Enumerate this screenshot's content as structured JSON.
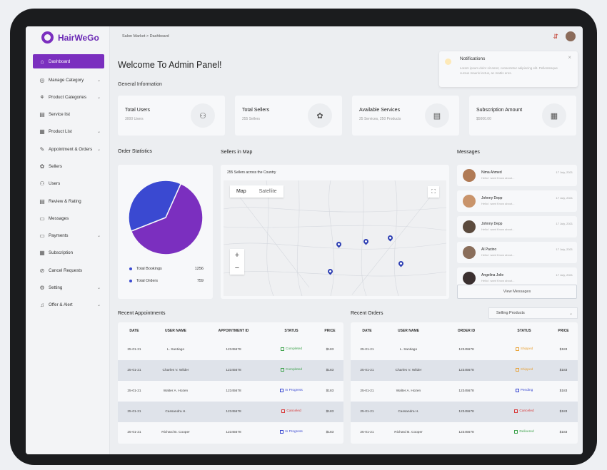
{
  "app": {
    "brand": "HairWeGo",
    "breadcrumb": "Salon Market  >  Dashboard"
  },
  "sidebar": {
    "items": [
      {
        "label": "Dashboard",
        "icon": "home-icon",
        "glyph": "⌂",
        "chev": false,
        "active": true
      },
      {
        "label": "Manage Category",
        "icon": "category-icon",
        "glyph": "◎",
        "chev": true
      },
      {
        "label": "Product Categories",
        "icon": "product-category-icon",
        "glyph": "⚘",
        "chev": true
      },
      {
        "label": "Service list",
        "icon": "document-icon",
        "glyph": "▤",
        "chev": false
      },
      {
        "label": "Product List",
        "icon": "grid-icon",
        "glyph": "▦",
        "chev": true
      },
      {
        "label": "Appointment & Orders",
        "icon": "edit-icon",
        "glyph": "✎",
        "chev": true
      },
      {
        "label": "Sellers",
        "icon": "seller-icon",
        "glyph": "✿",
        "chev": false
      },
      {
        "label": "Users",
        "icon": "users-icon",
        "glyph": "⚇",
        "chev": false
      },
      {
        "label": "Review & Rating",
        "icon": "review-icon",
        "glyph": "▤",
        "chev": false
      },
      {
        "label": "Messages",
        "icon": "message-icon",
        "glyph": "▭",
        "chev": false
      },
      {
        "label": "Payments",
        "icon": "payment-icon",
        "glyph": "▭",
        "chev": true
      },
      {
        "label": "Subscription",
        "icon": "subscription-icon",
        "glyph": "▦",
        "chev": false
      },
      {
        "label": "Cancel Requests",
        "icon": "cancel-icon",
        "glyph": "⊘",
        "chev": false
      },
      {
        "label": "Setting",
        "icon": "gear-icon",
        "glyph": "⚙",
        "chev": true
      },
      {
        "label": "Offer & Alert",
        "icon": "bell-icon",
        "glyph": "♫",
        "chev": true
      }
    ]
  },
  "main": {
    "welcome": "Welcome To Admin Panel!",
    "general": "General Information"
  },
  "notification": {
    "title": "Notifications",
    "text": "Lorem ipsum dolor sit amet, consectetur adipiscing elit. Pellentesque cursus mauris lectus, ac mattis eros."
  },
  "stats": [
    {
      "label": "Total Users",
      "sub": "3000 Users",
      "icon": "users-icon",
      "glyph": "⚇"
    },
    {
      "label": "Total Sellers",
      "sub": "255 Sellers",
      "icon": "seller-icon",
      "glyph": "✿"
    },
    {
      "label": "Available Services",
      "sub": "25 Services, 250 Products",
      "icon": "document-icon",
      "glyph": "▤"
    },
    {
      "label": "Subscription Amount",
      "sub": "$5000.00",
      "icon": "receipt-icon",
      "glyph": "▦"
    }
  ],
  "sections": {
    "order_stats": "Order Statistics",
    "sellers_map": "Sellers in Map",
    "messages": "Messages",
    "recent_appts": "Recent Appointments",
    "recent_orders": "Recent Orders"
  },
  "chart_data": {
    "type": "pie",
    "slices": [
      {
        "name": "Total Bookings",
        "value": 1256,
        "color": "#7b2fbf"
      },
      {
        "name": "Total Orders",
        "value": 759,
        "color": "#3a49d1"
      }
    ],
    "legend": [
      {
        "label": "Total Bookings",
        "value": "1256"
      },
      {
        "label": "Total Orders",
        "value": "759"
      }
    ]
  },
  "map": {
    "caption": "255 Sellers across the Country",
    "tab_map": "Map",
    "tab_satellite": "Satellite",
    "zoom_in": "+",
    "zoom_out": "−"
  },
  "messages": [
    {
      "name": "Nima Ahmed",
      "text": "Hello I want Know about...",
      "date": "17 July, 2021",
      "color": "#b07a55"
    },
    {
      "name": "Johnny Depp",
      "text": "Hello I want Know about...",
      "date": "17 July, 2021",
      "color": "#c9946b"
    },
    {
      "name": "Johnny Depp",
      "text": "Hello I want Know about...",
      "date": "17 July, 2021",
      "color": "#5b4a3d"
    },
    {
      "name": "Al Pacino",
      "text": "Hello I want Know about...",
      "date": "17 July, 2021",
      "color": "#8a6e5b"
    },
    {
      "name": "Angelina Jolie",
      "text": "Hello I want Know about...",
      "date": "17 July, 2021",
      "color": "#3b3030"
    }
  ],
  "view_messages": "View Messages",
  "orders_filter": "Selling Products",
  "appointments": {
    "headers": [
      "DATE",
      "USER NAME",
      "APPOINTMENT ID",
      "STATUS",
      "PRICE"
    ],
    "rows": [
      {
        "date": "25-01-21",
        "user": "L. Santiago",
        "id": "12345678",
        "status": "Completed",
        "price": "$183",
        "color": "#3fa34d"
      },
      {
        "date": "25-01-21",
        "user": "Charles V. Wilder",
        "id": "12345678",
        "status": "Completed",
        "price": "$183",
        "color": "#3fa34d"
      },
      {
        "date": "25-01-21",
        "user": "Walter A. Hozen",
        "id": "12345678",
        "status": "In Progress",
        "price": "$183",
        "color": "#3a49d1"
      },
      {
        "date": "25-01-21",
        "user": "Cassandra H.",
        "id": "12345678",
        "status": "Canceled",
        "price": "$183",
        "color": "#d93b3b"
      },
      {
        "date": "25-01-21",
        "user": "Richard B. Cooper",
        "id": "12345678",
        "status": "In Progress",
        "price": "$183",
        "color": "#3a49d1"
      }
    ]
  },
  "orders": {
    "headers": [
      "DATE",
      "USER NAME",
      "ORDER ID",
      "STATUS",
      "PRICE"
    ],
    "rows": [
      {
        "date": "25-01-21",
        "user": "L. Santiago",
        "id": "12345678",
        "status": "Shipped",
        "price": "$183",
        "color": "#e8a33a"
      },
      {
        "date": "25-01-21",
        "user": "Charles V. Wilder",
        "id": "12345678",
        "status": "Shipped",
        "price": "$183",
        "color": "#e8a33a"
      },
      {
        "date": "25-01-21",
        "user": "Walter A. Hozen",
        "id": "12345678",
        "status": "Pending",
        "price": "$183",
        "color": "#3a49d1"
      },
      {
        "date": "25-01-21",
        "user": "Cassandra H.",
        "id": "12345678",
        "status": "Canceled",
        "price": "$183",
        "color": "#d93b3b"
      },
      {
        "date": "25-01-21",
        "user": "Richard B. Cooper",
        "id": "12345678",
        "status": "Delivered",
        "price": "$183",
        "color": "#3fa34d"
      }
    ]
  }
}
